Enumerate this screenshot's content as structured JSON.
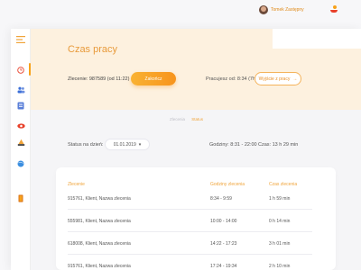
{
  "user": {
    "name": "Tomek Zastępny"
  },
  "header": {
    "title": "Czas pracy"
  },
  "order": {
    "label": "Zlecenie:",
    "value": "987589 (od 11:22)",
    "finish_button": "Zakończ",
    "working_label": "Pracujesz od:",
    "working_value": "8:34 (7h 23 min)",
    "exit_button": "Wyjście z pracy",
    "exit_arrow": "→"
  },
  "tabs": [
    {
      "label": "Zlecenia",
      "active": false
    },
    {
      "label": "Status",
      "active": true
    }
  ],
  "status": {
    "label": "Status na dzień:",
    "date": "01.01.2019",
    "date_chevron": "▾",
    "hours_label": "Godziny:",
    "hours_value": "8:31 - 22:00",
    "time_label": "Czas:",
    "time_value": "13 h 29 min"
  },
  "table": {
    "columns": [
      "Zlecenie",
      "Godziny zlecenia",
      "Czas zlecenia"
    ],
    "rows": [
      [
        "915761, Klient, Nazwa zlecenia",
        "8:34 - 9:59",
        "1 h 59 min"
      ],
      [
        "555981, Klient, Nazwa zlecenia",
        "10:00 - 14:00",
        "0 h 14 min"
      ],
      [
        "618008, Klient, Nazwa zlecenia",
        "14:22 - 17:23",
        "3 h 01 min"
      ],
      [
        "915761, Klient, Nazwa zlecenia",
        "17:24 - 19:34",
        "2 h 10 min"
      ]
    ]
  },
  "colors": {
    "accent": "#f7a21b",
    "hero_bg": "#fdf1df",
    "flag_red": "#e8402a"
  },
  "icons": {
    "menu": "menu-icon",
    "clock": "clock-icon",
    "users": "users-icon",
    "briefcase": "briefcase-icon",
    "eye": "eye-icon",
    "bell": "bell-icon",
    "globe": "globe-icon",
    "logout": "logout-icon"
  }
}
